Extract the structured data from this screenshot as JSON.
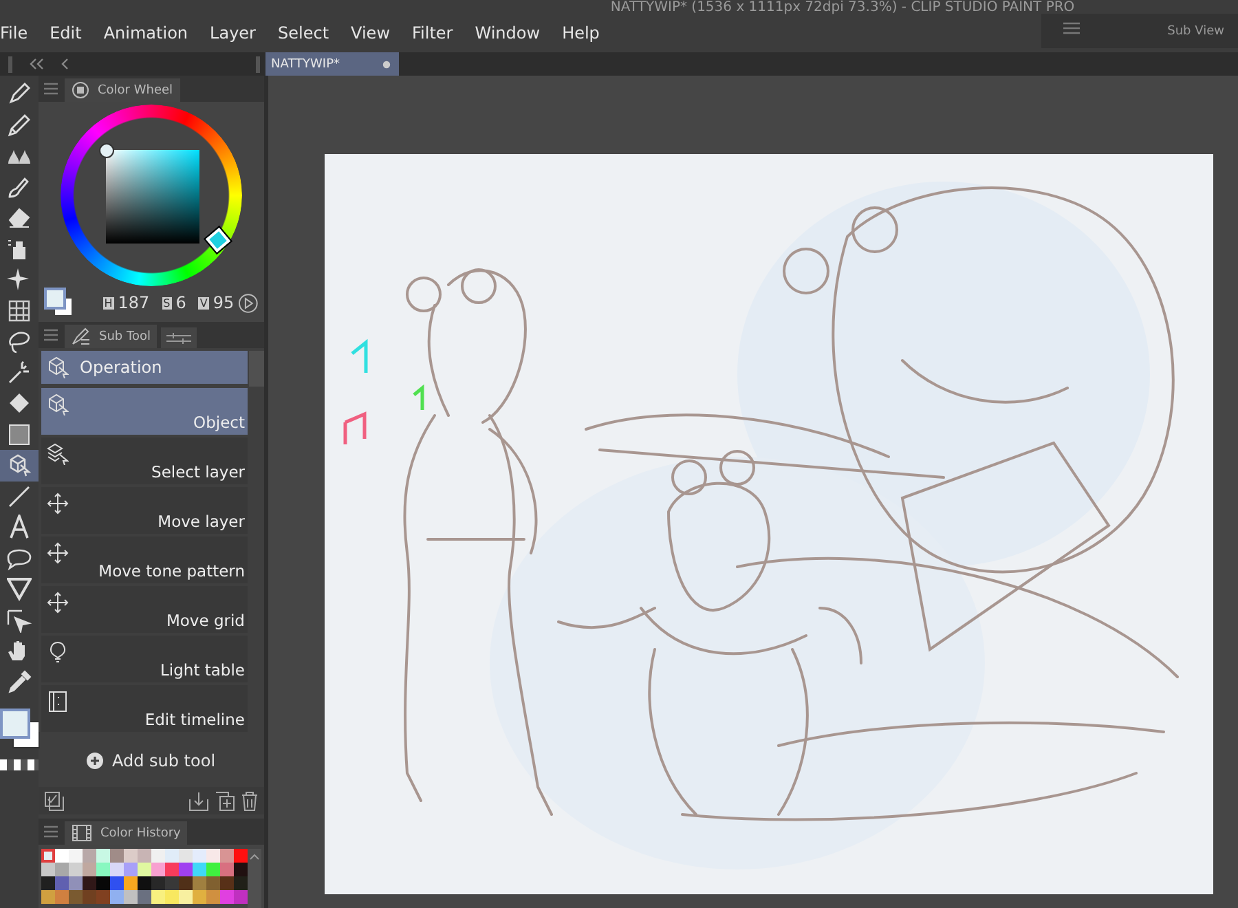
{
  "window": {
    "title": "NATTYWIP* (1536 x 1111px 72dpi 73.3%) - CLIP STUDIO PAINT PRO"
  },
  "menu": [
    "File",
    "Edit",
    "Animation",
    "Layer",
    "Select",
    "View",
    "Filter",
    "Window",
    "Help"
  ],
  "sub_view": {
    "title": "Sub View"
  },
  "document_tabs": [
    {
      "label": "NATTYWIP*",
      "selected": true
    }
  ],
  "tools": [
    {
      "kind": "pen",
      "selected": false
    },
    {
      "kind": "pencil",
      "selected": false
    },
    {
      "kind": "blend",
      "selected": false
    },
    {
      "kind": "ink",
      "selected": false
    },
    {
      "kind": "eraser",
      "selected": false
    },
    {
      "kind": "airbrush",
      "selected": false
    },
    {
      "kind": "sparkle",
      "selected": false
    },
    {
      "kind": "grid",
      "selected": false
    },
    {
      "kind": "lasso",
      "selected": false
    },
    {
      "kind": "wand",
      "selected": false
    },
    {
      "kind": "fill",
      "selected": false
    },
    {
      "kind": "gradient",
      "selected": false
    },
    {
      "kind": "operation",
      "selected": true
    },
    {
      "kind": "line",
      "selected": false
    },
    {
      "kind": "text",
      "selected": false
    },
    {
      "kind": "balloon",
      "selected": false
    },
    {
      "kind": "ruler",
      "selected": false
    },
    {
      "kind": "link",
      "selected": false
    },
    {
      "kind": "hand",
      "selected": false
    },
    {
      "kind": "eyedropper",
      "selected": false
    }
  ],
  "color_wheel": {
    "title": "Color Wheel",
    "h_label": "H",
    "h": "187",
    "s_label": "S",
    "s": "6",
    "v_label": "V",
    "v": "95"
  },
  "sub_tool": {
    "title": "Sub Tool",
    "group": "Operation",
    "add_label": "Add sub tool",
    "items": [
      {
        "label": "Object",
        "kind": "object",
        "selected": true
      },
      {
        "label": "Select layer",
        "kind": "layers",
        "selected": false
      },
      {
        "label": "Move layer",
        "kind": "move",
        "selected": false
      },
      {
        "label": "Move tone pattern",
        "kind": "move",
        "selected": false
      },
      {
        "label": "Move grid",
        "kind": "move",
        "selected": false
      },
      {
        "label": "Light table",
        "kind": "bulb",
        "selected": false
      },
      {
        "label": "Edit timeline",
        "kind": "timeline",
        "selected": false
      }
    ]
  },
  "color_history": {
    "title": "Color History",
    "swatches": [
      {
        "color": "#e4f0f4",
        "selected": true
      },
      {
        "color": "#ffffff",
        "selected": false
      },
      {
        "color": "#f4f4f4",
        "selected": false
      },
      {
        "color": "#b8a8a8",
        "selected": false
      },
      {
        "color": "#c8f8e4",
        "selected": false
      },
      {
        "color": "#a08c88",
        "selected": false
      },
      {
        "color": "#dcccc8",
        "selected": false
      },
      {
        "color": "#c8b4b4",
        "selected": false
      },
      {
        "color": "#f0f0f0",
        "selected": false
      },
      {
        "color": "#e0ecf8",
        "selected": false
      },
      {
        "color": "#e4e4e4",
        "selected": false
      },
      {
        "color": "#e4ecfc",
        "selected": false
      },
      {
        "color": "#f8e8e8",
        "selected": false
      },
      {
        "color": "#d89494",
        "selected": false
      },
      {
        "color": "#ff1010",
        "selected": false
      },
      {
        "color": "#c8c8c8",
        "selected": false
      },
      {
        "color": "#a8a8a8",
        "selected": false
      },
      {
        "color": "#d0d0d0",
        "selected": false
      },
      {
        "color": "#c0a8a0",
        "selected": false
      },
      {
        "color": "#88f8c0",
        "selected": false
      },
      {
        "color": "#d8d8f8",
        "selected": false
      },
      {
        "color": "#a8a0f8",
        "selected": false
      },
      {
        "color": "#e0f8a0",
        "selected": false
      },
      {
        "color": "#f8a0d0",
        "selected": false
      },
      {
        "color": "#f83c5c",
        "selected": false
      },
      {
        "color": "#a040f0",
        "selected": false
      },
      {
        "color": "#40d8f8",
        "selected": false
      },
      {
        "color": "#40f040",
        "selected": false
      },
      {
        "color": "#d87080",
        "selected": false
      },
      {
        "color": "#201010",
        "selected": false
      },
      {
        "color": "#202020",
        "selected": false
      },
      {
        "color": "#6060b0",
        "selected": false
      },
      {
        "color": "#9090b8",
        "selected": false
      },
      {
        "color": "#301818",
        "selected": false
      },
      {
        "color": "#080808",
        "selected": false
      },
      {
        "color": "#3050f0",
        "selected": false
      },
      {
        "color": "#f8a820",
        "selected": false
      },
      {
        "color": "#101010",
        "selected": false
      },
      {
        "color": "#282828",
        "selected": false
      },
      {
        "color": "#383838",
        "selected": false
      },
      {
        "color": "#503018",
        "selected": false
      },
      {
        "color": "#a08040",
        "selected": false
      },
      {
        "color": "#806030",
        "selected": false
      },
      {
        "color": "#583018",
        "selected": false
      },
      {
        "color": "#202018",
        "selected": false
      },
      {
        "color": "#d0a040",
        "selected": false
      },
      {
        "color": "#d08040",
        "selected": false
      },
      {
        "color": "#7a5a30",
        "selected": false
      },
      {
        "color": "#704020",
        "selected": false
      },
      {
        "color": "#804020",
        "selected": false
      },
      {
        "color": "#90b0f0",
        "selected": false
      },
      {
        "color": "#c0c0c0",
        "selected": false
      },
      {
        "color": "#6a7080",
        "selected": false
      },
      {
        "color": "#f8f080",
        "selected": false
      },
      {
        "color": "#f8e860",
        "selected": false
      },
      {
        "color": "#f8f0a0",
        "selected": false
      },
      {
        "color": "#e0b040",
        "selected": false
      },
      {
        "color": "#d09040",
        "selected": false
      },
      {
        "color": "#e040e0",
        "selected": false
      },
      {
        "color": "#c030c0",
        "selected": false
      }
    ]
  }
}
